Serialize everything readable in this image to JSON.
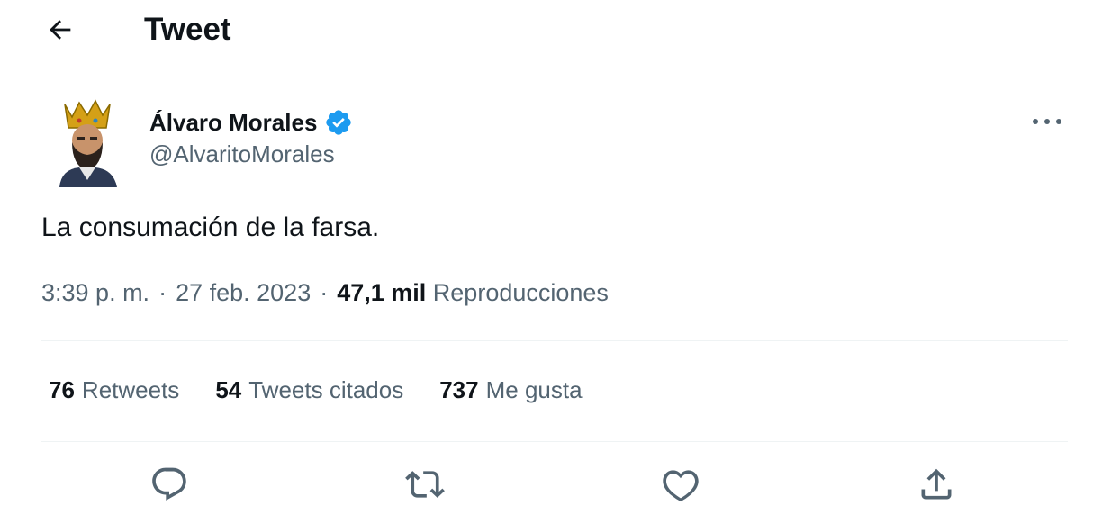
{
  "header": {
    "title": "Tweet",
    "back_icon": "arrow-left-icon"
  },
  "author": {
    "name": "Álvaro Morales",
    "handle": "@AlvaritoMorales",
    "verified_icon": "verified-badge-icon",
    "verified_color": "#1d9bf0"
  },
  "tweet": {
    "text": "La consumación de la farsa.",
    "time": "3:39 p. m.",
    "sep1": "·",
    "date": "27 feb. 2023",
    "sep2": "·",
    "views_count": "47,1 mil",
    "views_label": "Reproducciones"
  },
  "stats": [
    {
      "count": "76",
      "label": "Retweets"
    },
    {
      "count": "54",
      "label": "Tweets citados"
    },
    {
      "count": "737",
      "label": "Me gusta"
    }
  ],
  "actions": [
    {
      "icon": "reply-icon"
    },
    {
      "icon": "retweet-icon"
    },
    {
      "icon": "like-icon"
    },
    {
      "icon": "share-icon"
    }
  ],
  "colors": {
    "text": "#0f1419",
    "secondary": "#536471",
    "accent": "#1d9bf0",
    "divider": "#eff3f4"
  }
}
